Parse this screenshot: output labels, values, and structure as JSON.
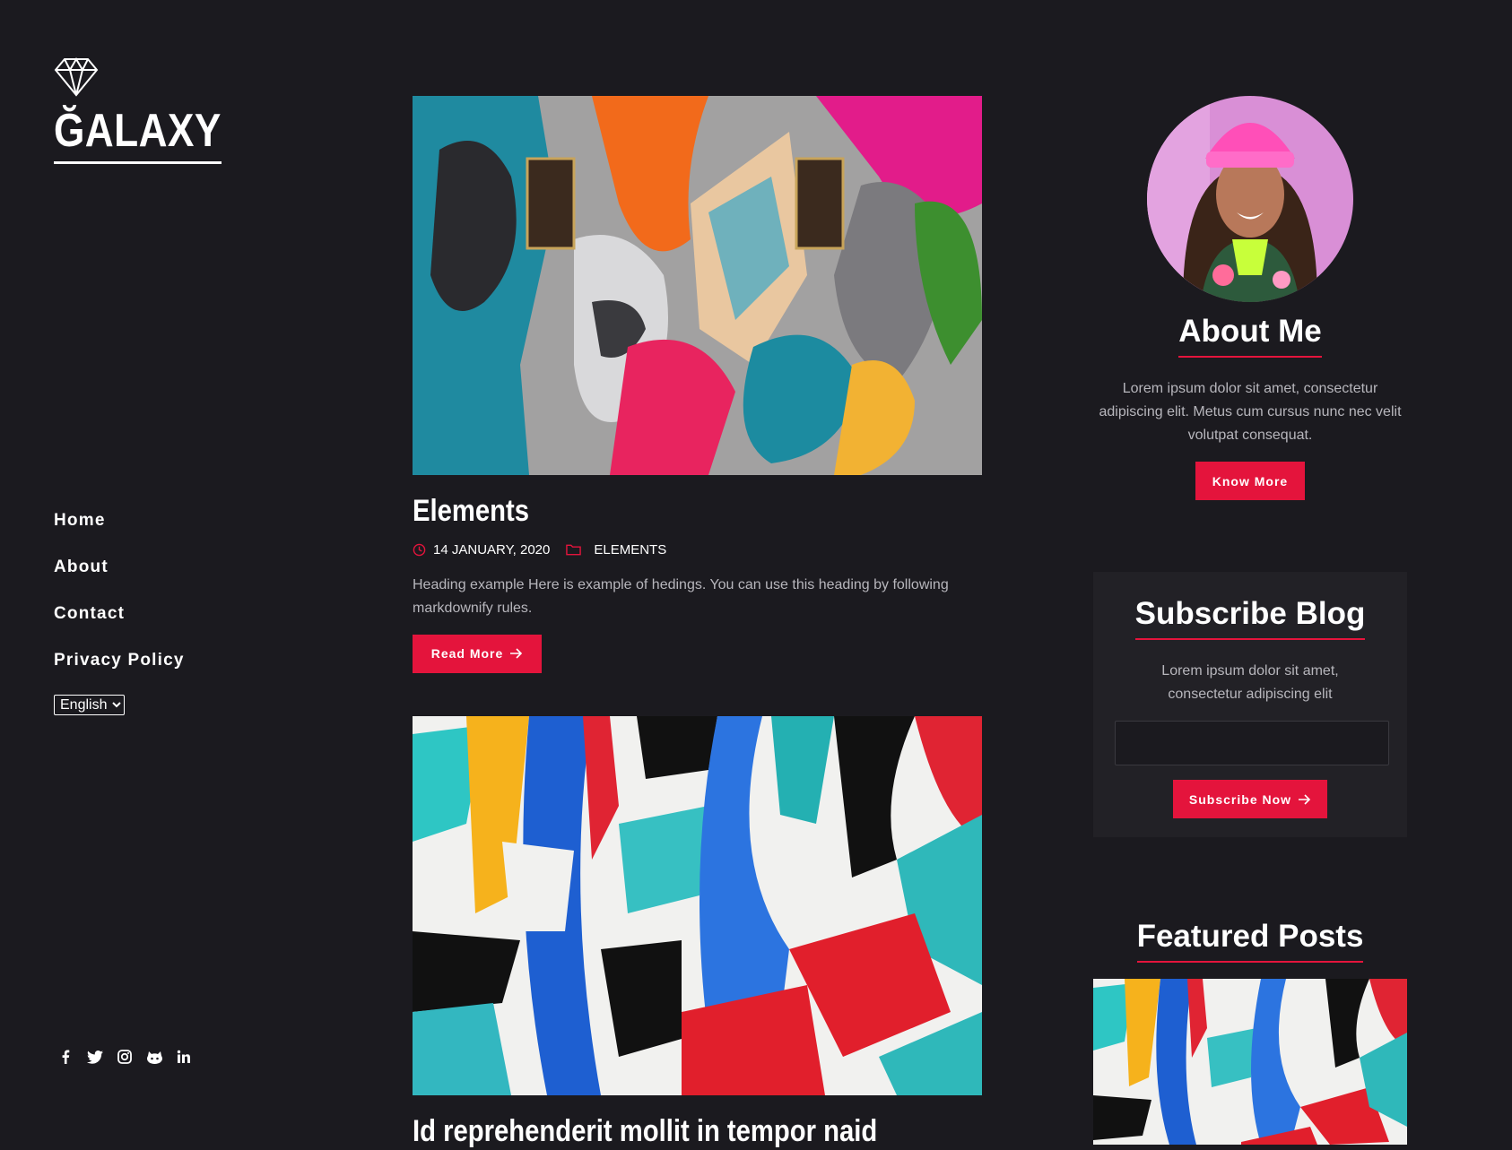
{
  "brand": {
    "name": "ĞALAXY"
  },
  "nav": {
    "items": [
      {
        "label": "Home"
      },
      {
        "label": "About"
      },
      {
        "label": "Contact"
      },
      {
        "label": "Privacy Policy"
      }
    ]
  },
  "language": {
    "selected": "English"
  },
  "socials": [
    "facebook-icon",
    "twitter-icon",
    "instagram-icon",
    "github-icon",
    "linkedin-icon"
  ],
  "posts": [
    {
      "title": "Elements",
      "date": "14 JANUARY, 2020",
      "category": "ELEMENTS",
      "excerpt": "Heading example Here is example of hedings. You can use this heading by following markdownify rules.",
      "read_more": "Read More"
    },
    {
      "title": "Id reprehenderit mollit in tempor naid"
    }
  ],
  "about": {
    "title": "About Me",
    "text": "Lorem ipsum dolor sit amet, consectetur adipiscing elit. Metus cum cursus nunc nec velit volutpat consequat.",
    "button": "Know More"
  },
  "subscribe": {
    "title": "Subscribe Blog",
    "text": "Lorem ipsum dolor sit amet, consectetur adipiscing elit",
    "button": "Subscribe Now"
  },
  "featured": {
    "title": "Featured Posts"
  },
  "colors": {
    "accent": "#e4143c",
    "background": "#1b1a1f",
    "panel": "#222126"
  }
}
